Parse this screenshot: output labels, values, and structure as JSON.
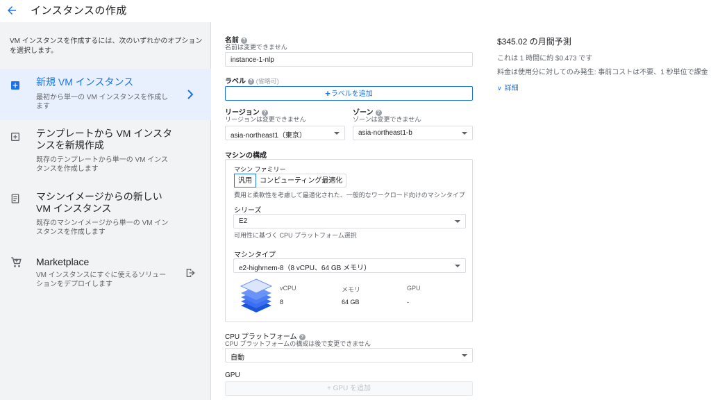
{
  "header": {
    "title": "インスタンスの作成"
  },
  "sidebar": {
    "intro": "VM インスタンスを作成するには、次のいずれかのオプションを選択します。",
    "options": [
      {
        "title": "新規 VM インスタンス",
        "desc": "最初から単一の VM インスタンスを作成します",
        "icon": "add-box-icon",
        "selected": true
      },
      {
        "title": "テンプレートから VM インスタンスを新規作成",
        "desc": "既存のテンプレートから単一の VM インスタンスを作成します",
        "icon": "template-icon"
      },
      {
        "title": "マシンイメージからの新しい VM インスタンス",
        "desc": "既存のマシンイメージから単一の VM インスタンスを作成します",
        "icon": "machine-image-icon"
      },
      {
        "title": "Marketplace",
        "desc": "VM インスタンスにすぐに使えるソリューションをデプロイします",
        "icon": "cart-icon"
      }
    ]
  },
  "form": {
    "name": {
      "label": "名前",
      "sub": "名前は変更できません",
      "value": "instance-1-nlp"
    },
    "labels": {
      "label": "ラベル",
      "optional": "(省略可)",
      "button": "ラベルを追加"
    },
    "region": {
      "label": "リージョン",
      "sub": "リージョンは変更できません",
      "value": "asia-northeast1（東京）"
    },
    "zone": {
      "label": "ゾーン",
      "sub": "ゾーンは変更できません",
      "value": "asia-northeast1-b"
    },
    "machine": {
      "section_label": "マシンの構成",
      "family_label": "マシン ファミリー",
      "tabs": [
        "汎用",
        "コンピューティング最適化"
      ],
      "family_desc": "費用と柔軟性を考慮して最適化された、一般的なワークロード向けのマシンタイプ",
      "series_label": "シリーズ",
      "series_value": "E2",
      "series_sub": "可用性に基づく CPU プラットフォーム選択",
      "type_label": "マシンタイプ",
      "type_value": "e2-highmem-8（8 vCPU、64 GB メモリ）",
      "spec": {
        "headers": [
          "vCPU",
          "メモリ",
          "GPU"
        ],
        "values": [
          "8",
          "64 GB",
          "-"
        ]
      }
    },
    "cpu_platform": {
      "label": "CPU プラットフォーム",
      "sub": "CPU プラットフォームの構成は後で変更できません",
      "value": "自動"
    },
    "gpu": {
      "label": "GPU",
      "button": "GPU を追加"
    }
  },
  "cost": {
    "title": "$345.02 の月間予測",
    "line1": "これは 1 時間に約 $0.473 です",
    "line2": "料金は使用分に対してのみ発生: 事前コストは不要、1 秒単位で課金",
    "details": "詳細"
  },
  "colors": {
    "accent": "#1a73e8",
    "sidebar_bg": "#f1f3f4",
    "selected_bg": "#e8f0fe"
  }
}
